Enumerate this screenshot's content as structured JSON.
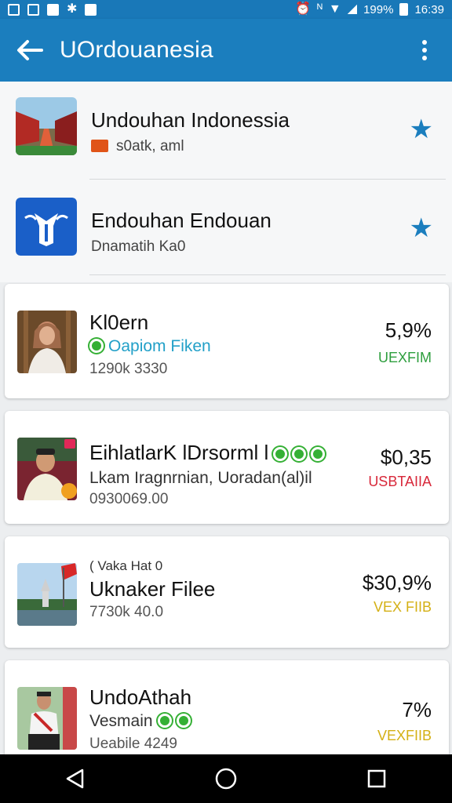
{
  "status_bar": {
    "signal_label": "ᴿ",
    "battery_label": "199%",
    "time": "16:39",
    "icons": [
      "image-icon",
      "edit-icon",
      "mail-icon",
      "bluetooth-icon",
      "bag-icon",
      "alarm-icon",
      "vibrate-icon",
      "wifi-icon",
      "signal-icon",
      "battery-icon"
    ]
  },
  "app_bar": {
    "title": "UOrdouanesia",
    "back_icon": "back-arrow-icon",
    "menu_icon": "more-vert-icon"
  },
  "plain_items": [
    {
      "title": "Undouhan Indonessia",
      "subtitle": "s0atk, aml",
      "icon": "gift-icon",
      "star_icon": "star-icon"
    },
    {
      "title": "Endouhan Endouan",
      "subtitle": "Dnamatih Ka0",
      "star_icon": "star-icon"
    }
  ],
  "cards": [
    {
      "name": "Kl0ern",
      "sub": "Oapiom Fiken",
      "meta": "1290k 3330",
      "value": "5,9%",
      "tag": "UEXFIM",
      "tag_color": "#2e9e3e"
    },
    {
      "name": "EihlatlarK lDrsorml l",
      "sub": "Lkam Iragnrnian, Uoradan(al)il",
      "meta": "0930069.00",
      "value": "$0,35",
      "tag": "USBTAIIA",
      "tag_color": "#d8283a"
    },
    {
      "pre": "( Vaka Hat 0",
      "name": "Uknaker Filee",
      "meta": "7730k 40.0",
      "value": "$30,9%",
      "tag": "VEX FIIB",
      "tag_color": "#d4b015"
    },
    {
      "name": "UndoAthah",
      "sub": "Vesmain",
      "meta": "Ueabile 4249",
      "value": "7%",
      "tag": "VEXFIIB",
      "tag_color": "#d4b015"
    }
  ],
  "colors": {
    "primary": "#1b7ebe",
    "status": "#1978b8",
    "green_dot": "#35b035"
  },
  "nav": {
    "back": "nav-back-icon",
    "home": "nav-home-icon",
    "recents": "nav-recents-icon"
  }
}
